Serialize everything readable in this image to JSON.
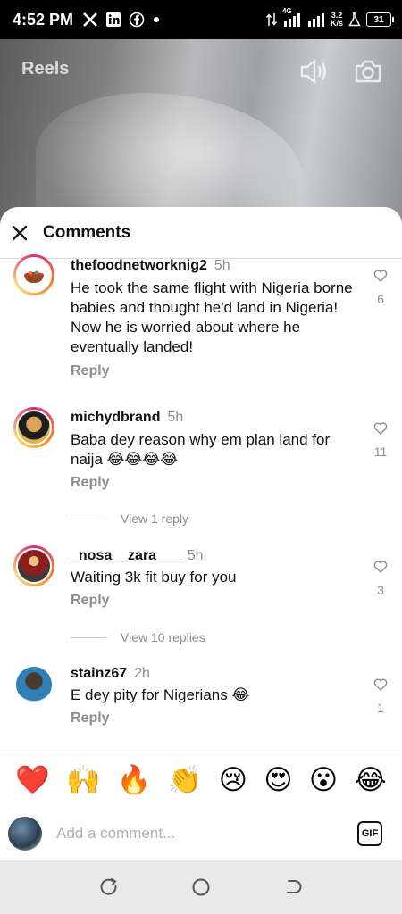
{
  "status_bar": {
    "time": "4:52 PM",
    "network_label": "4G",
    "speed_value": "3.2",
    "speed_unit": "K/s",
    "battery": "31",
    "left_icons": [
      "x-icon",
      "linkedin-icon",
      "facebook-icon",
      "dot-icon"
    ]
  },
  "reels": {
    "title": "Reels"
  },
  "sheet": {
    "title": "Comments"
  },
  "comments": [
    {
      "username": "thefoodnetworknig2",
      "time": "5h",
      "text": "He took the same flight with Nigeria borne babies and thought he'd land in Nigeria! Now he is worried about where he eventually landed!",
      "reply_label": "Reply",
      "likes": "6"
    },
    {
      "username": "michydbrand",
      "time": "5h",
      "text": "Baba dey reason why em plan land for naija 😂😂😂😂",
      "reply_label": "Reply",
      "likes": "11",
      "view_replies": "View 1 reply"
    },
    {
      "username": "_nosa__zara___",
      "time": "5h",
      "text": "Waiting 3k fit buy for you",
      "reply_label": "Reply",
      "likes": "3",
      "view_replies": "View 10 replies"
    },
    {
      "username": "stainz67",
      "time": "2h",
      "text": "E dey pity for Nigerians 😂",
      "reply_label": "Reply",
      "likes": "1"
    }
  ],
  "emoji_bar": [
    "❤️",
    "🙌",
    "🔥",
    "👏",
    "😢",
    "😍",
    "😮",
    "😂"
  ],
  "input": {
    "placeholder": "Add a comment...",
    "gif_label": "GIF"
  },
  "colors": {
    "ring_start": "#d82b7e",
    "ring_end": "#f58529",
    "secondary_text": "#8e8e8e"
  }
}
